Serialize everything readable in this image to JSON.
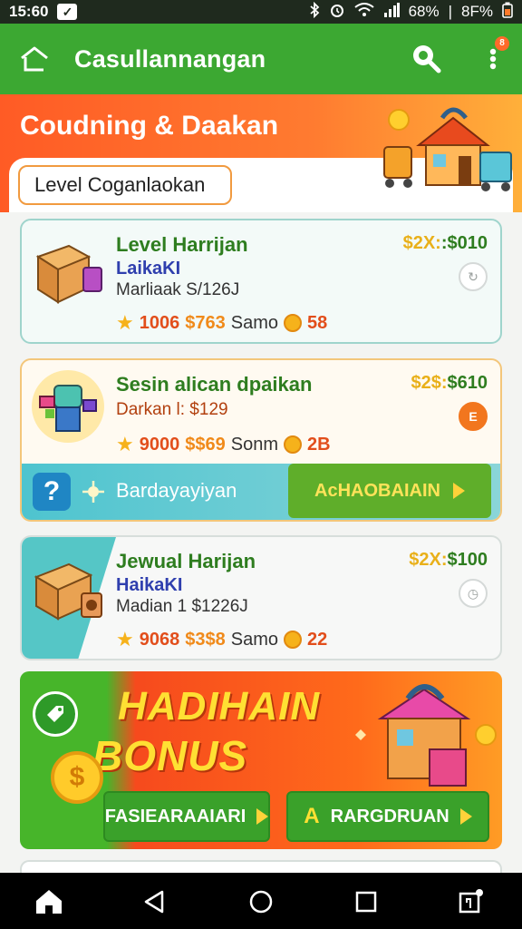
{
  "status_bar": {
    "time": "15:60",
    "notif_glyph": "✓",
    "battery_left": "68%",
    "battery_right": "8F%"
  },
  "app_bar": {
    "title": "Casullannangan",
    "more_badge": "8"
  },
  "hero": {
    "title": "Coudning & Daakan",
    "level_chip": "Level Coganlaokan"
  },
  "cards": [
    {
      "name": "Level Harrijan",
      "sub": "LaikaKI",
      "meta": "Marliaak S/126J",
      "stat_num": "1006",
      "stat_money": "$763",
      "stat_word": "Samo",
      "stat_coin": "58",
      "price_a": "$2X:",
      "price_b": ":$010",
      "status_icon": "refresh-icon"
    },
    {
      "name": "Sesin alican  dpaikan",
      "sub": "",
      "meta": "Darkan l: $129",
      "stat_num": "9000",
      "stat_money": "$$69",
      "stat_word": "Sonm",
      "stat_coin": "2B",
      "price_a": "$2$:",
      "price_b": "$610",
      "status_text": "E",
      "bar_text": "Bardayayiyan",
      "cta_label": "AcHAOBAIAIN"
    },
    {
      "name": "Jewual Harijan",
      "sub": "HaikaKI",
      "meta": "Madian 1 $1226J",
      "stat_num": "9068",
      "stat_money": "$3$8",
      "stat_word": "Samo",
      "stat_coin": "22",
      "price_a": "$2X:",
      "price_b": "$100",
      "status_icon": "clock-icon"
    }
  ],
  "bonus": {
    "line1": "HADIHAIN",
    "line2": "BONUS",
    "coin_symbol": "$",
    "btn1_label": "FASIEARAAIARI",
    "btn2_lead": "A",
    "btn2_label": "RARGDRUAN"
  },
  "colors": {
    "primary": "#3ca832",
    "hero": "#ff5b25",
    "accent": "#f08a1a"
  }
}
